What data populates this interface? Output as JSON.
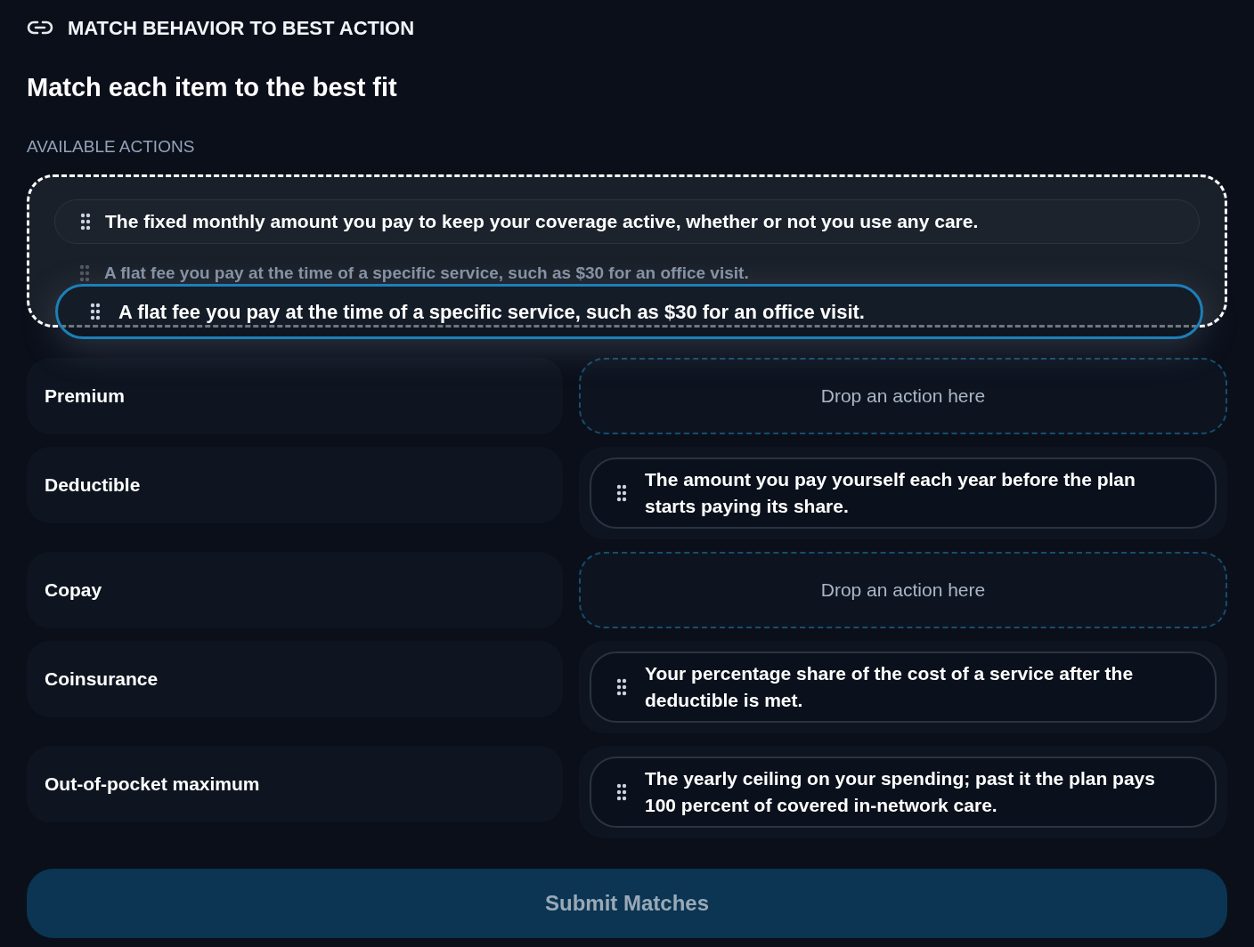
{
  "header": {
    "title": "MATCH BEHAVIOR TO BEST ACTION"
  },
  "heading": "Match each item to the best fit",
  "pool": {
    "label": "AVAILABLE ACTIONS",
    "drop_target": true,
    "items": [
      {
        "text": "The fixed monthly amount you pay to keep your coverage active, whether or not you use any care.",
        "dragging": false
      },
      {
        "text": "A flat fee you pay at the time of a specific service, such as $30 for an office visit.",
        "dragging": true
      }
    ],
    "dragged": {
      "text": "A flat fee you pay at the time of a specific service, such as $30 for an office visit."
    }
  },
  "rows": [
    {
      "term": "Premium",
      "slot": {
        "kind": "empty",
        "hint": "Drop an action here"
      }
    },
    {
      "term": "Deductible",
      "slot": {
        "kind": "filled",
        "text": "The amount you pay yourself each year before the plan starts paying its share."
      }
    },
    {
      "term": "Copay",
      "slot": {
        "kind": "empty",
        "hint": "Drop an action here"
      }
    },
    {
      "term": "Coinsurance",
      "slot": {
        "kind": "filled",
        "text": "Your percentage share of the cost of a service after the deductible is met."
      }
    },
    {
      "term": "Out-of-pocket maximum",
      "slot": {
        "kind": "filled",
        "text": "The yearly ceiling on your spending; past it the plan pays 100 percent of covered in-network care."
      }
    }
  ],
  "submit": {
    "label": "Submit Matches",
    "disabled": true
  }
}
